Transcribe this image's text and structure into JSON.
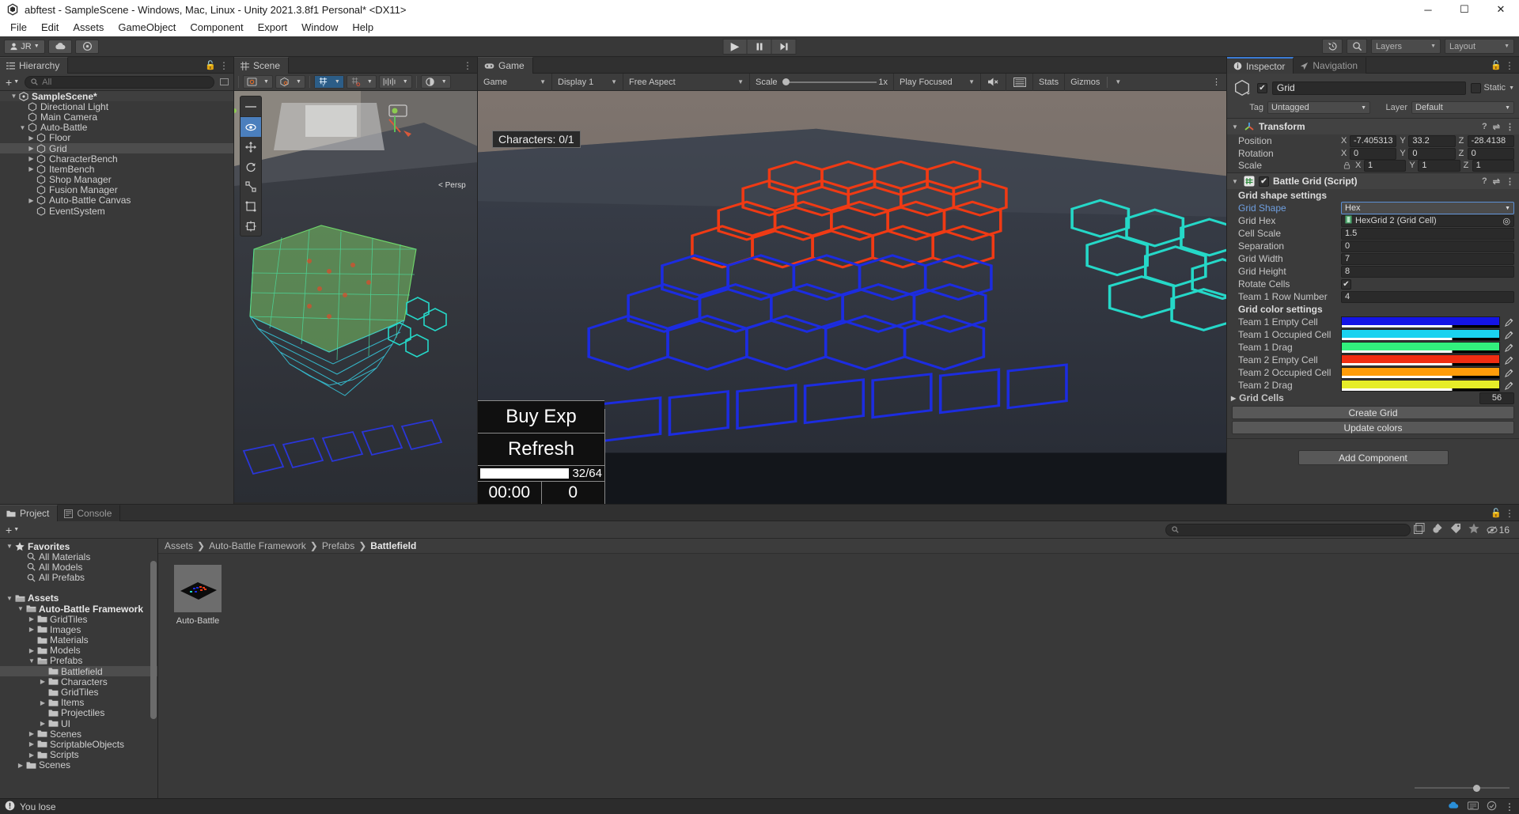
{
  "window": {
    "title": "abftest - SampleScene - Windows, Mac, Linux - Unity 2021.3.8f1 Personal* <DX11>",
    "minimize": "─",
    "maximize": "☐",
    "close": "✕"
  },
  "menubar": {
    "items": [
      "File",
      "Edit",
      "Assets",
      "GameObject",
      "Component",
      "Export",
      "Window",
      "Help"
    ]
  },
  "toolbar": {
    "account": "JR",
    "cloud_icon": "cloud-icon",
    "services_icon": "collab-icon",
    "play": "▶",
    "pause": "❙❙",
    "step": "▶❙",
    "undo_history_icon": "undo-history-icon",
    "search_icon": "search-icon",
    "layers": "Layers",
    "layout": "Layout"
  },
  "hierarchy": {
    "tab": "Hierarchy",
    "search_placeholder": "All",
    "add_label": "+",
    "items": [
      {
        "label": "SampleScene*",
        "depth": 0,
        "arrow": "down",
        "icon": "scene-icon",
        "selected": false,
        "scene": true
      },
      {
        "label": "Directional Light",
        "depth": 1,
        "arrow": "none",
        "icon": "gameobject-icon",
        "selected": false
      },
      {
        "label": "Main Camera",
        "depth": 1,
        "arrow": "none",
        "icon": "gameobject-icon",
        "selected": false
      },
      {
        "label": "Auto-Battle",
        "depth": 1,
        "arrow": "down",
        "icon": "gameobject-icon",
        "selected": false
      },
      {
        "label": "Floor",
        "depth": 2,
        "arrow": "right",
        "icon": "gameobject-icon",
        "selected": false
      },
      {
        "label": "Grid",
        "depth": 2,
        "arrow": "right",
        "icon": "gameobject-icon",
        "selected": true
      },
      {
        "label": "CharacterBench",
        "depth": 2,
        "arrow": "right",
        "icon": "gameobject-icon",
        "selected": false
      },
      {
        "label": "ItemBench",
        "depth": 2,
        "arrow": "right",
        "icon": "gameobject-icon",
        "selected": false
      },
      {
        "label": "Shop Manager",
        "depth": 2,
        "arrow": "none",
        "icon": "gameobject-icon",
        "selected": false
      },
      {
        "label": "Fusion Manager",
        "depth": 2,
        "arrow": "none",
        "icon": "gameobject-icon",
        "selected": false
      },
      {
        "label": "Auto-Battle Canvas",
        "depth": 2,
        "arrow": "right",
        "icon": "gameobject-icon",
        "selected": false
      },
      {
        "label": "EventSystem",
        "depth": 2,
        "arrow": "none",
        "icon": "gameobject-icon",
        "selected": false
      }
    ]
  },
  "scene_view": {
    "tab": "Scene",
    "persp_label": "< Persp",
    "tools": [
      "hand-tool",
      "move-tool",
      "rotate-tool",
      "scale-tool",
      "rect-tool",
      "transform-tool"
    ],
    "toolbar_groups": [
      "draw-mode",
      "2d-toggle",
      "lighting-toggle",
      "audio-toggle",
      "gizmos-visibility",
      "grid-snap",
      "fx-dropdown"
    ]
  },
  "game_view": {
    "tab": "Game",
    "display_mode": "Game",
    "display": "Display 1",
    "aspect": "Free Aspect",
    "scale_label": "Scale",
    "scale_value": "1x",
    "play_mode": "Play Focused",
    "mute_icon": "mute-audio-icon",
    "stats": "Stats",
    "gizmos": "Gizmos",
    "hud": {
      "characters": "Characters: 0/1",
      "buy_exp": "Buy Exp",
      "refresh": "Refresh",
      "gold_bar": "32/64",
      "timer": "00:00",
      "score": "0"
    }
  },
  "inspector": {
    "tab": "Inspector",
    "nav_tab": "Navigation",
    "object_name": "Grid",
    "enabled": true,
    "static_label": "Static",
    "tag_label": "Tag",
    "tag_value": "Untagged",
    "layer_label": "Layer",
    "layer_value": "Default",
    "transform": {
      "title": "Transform",
      "position_label": "Position",
      "rotation_label": "Rotation",
      "scale_label": "Scale",
      "position": {
        "x": "-7.405313",
        "y": "33.2",
        "z": "-28.4138"
      },
      "rotation": {
        "x": "0",
        "y": "0",
        "z": "0"
      },
      "scale": {
        "x": "1",
        "y": "1",
        "z": "1"
      },
      "axis": {
        "x": "X",
        "y": "Y",
        "z": "Z"
      }
    },
    "battle_grid": {
      "title": "Battle Grid (Script)",
      "enabled": true,
      "shape_section": "Grid shape settings",
      "grid_shape_label": "Grid Shape",
      "grid_shape_value": "Hex",
      "rows": [
        {
          "label": "Grid Hex",
          "value": "HexGrid 2 (Grid Cell)",
          "type": "object"
        },
        {
          "label": "Cell Scale",
          "value": "1.5",
          "type": "text"
        },
        {
          "label": "Separation",
          "value": "0",
          "type": "text"
        },
        {
          "label": "Grid Width",
          "value": "7",
          "type": "text"
        },
        {
          "label": "Grid Height",
          "value": "8",
          "type": "text"
        },
        {
          "label": "Rotate Cells",
          "value": "",
          "type": "checkbox",
          "checked": true
        },
        {
          "label": "Team 1 Row Number",
          "value": "4",
          "type": "text"
        }
      ],
      "color_section": "Grid color settings",
      "colors": [
        {
          "label": "Team 1 Empty Cell",
          "hex": "#1414e6"
        },
        {
          "label": "Team 1 Occupied Cell",
          "hex": "#1ad2f0"
        },
        {
          "label": "Team 1 Drag",
          "hex": "#32f07d"
        },
        {
          "label": "Team 2 Empty Cell",
          "hex": "#f02d12"
        },
        {
          "label": "Team 2 Occupied Cell",
          "hex": "#ff9c0a"
        },
        {
          "label": "Team 2 Drag",
          "hex": "#e6ed28"
        }
      ],
      "grid_cells_label": "Grid Cells",
      "grid_cells_count": "56",
      "create_grid": "Create Grid",
      "update_colors": "Update colors"
    },
    "add_component": "Add Component"
  },
  "project": {
    "tab": "Project",
    "console_tab": "Console",
    "add_label": "+",
    "search_placeholder": "",
    "hidden_count": "16",
    "breadcrumb": [
      "Assets",
      "Auto-Battle Framework",
      "Prefabs",
      "Battlefield"
    ],
    "tree": [
      {
        "label": "Favorites",
        "depth": 0,
        "arrow": "down",
        "icon": "star-icon",
        "bold": true
      },
      {
        "label": "All Materials",
        "depth": 1,
        "arrow": "none",
        "icon": "search-icon"
      },
      {
        "label": "All Models",
        "depth": 1,
        "arrow": "none",
        "icon": "search-icon"
      },
      {
        "label": "All Prefabs",
        "depth": 1,
        "arrow": "none",
        "icon": "search-icon"
      },
      {
        "label": "",
        "depth": 0,
        "arrow": "none",
        "icon": "none",
        "spacer": true
      },
      {
        "label": "Assets",
        "depth": 0,
        "arrow": "down",
        "icon": "folder-open-icon",
        "bold": true
      },
      {
        "label": "Auto-Battle Framework",
        "depth": 1,
        "arrow": "down",
        "icon": "folder-open-icon",
        "bold": true
      },
      {
        "label": "GridTiles",
        "depth": 2,
        "arrow": "right",
        "icon": "folder-icon"
      },
      {
        "label": "Images",
        "depth": 2,
        "arrow": "right",
        "icon": "folder-icon"
      },
      {
        "label": "Materials",
        "depth": 2,
        "arrow": "none",
        "icon": "folder-icon"
      },
      {
        "label": "Models",
        "depth": 2,
        "arrow": "right",
        "icon": "folder-icon"
      },
      {
        "label": "Prefabs",
        "depth": 2,
        "arrow": "down",
        "icon": "folder-open-icon"
      },
      {
        "label": "Battlefield",
        "depth": 3,
        "arrow": "none",
        "icon": "folder-icon",
        "selected": true
      },
      {
        "label": "Characters",
        "depth": 3,
        "arrow": "right",
        "icon": "folder-icon"
      },
      {
        "label": "GridTiles",
        "depth": 3,
        "arrow": "none",
        "icon": "folder-icon"
      },
      {
        "label": "Items",
        "depth": 3,
        "arrow": "right",
        "icon": "folder-icon"
      },
      {
        "label": "Projectiles",
        "depth": 3,
        "arrow": "none",
        "icon": "folder-icon"
      },
      {
        "label": "UI",
        "depth": 3,
        "arrow": "right",
        "icon": "folder-icon"
      },
      {
        "label": "Scenes",
        "depth": 2,
        "arrow": "right",
        "icon": "folder-icon"
      },
      {
        "label": "ScriptableObjects",
        "depth": 2,
        "arrow": "right",
        "icon": "folder-icon"
      },
      {
        "label": "Scripts",
        "depth": 2,
        "arrow": "right",
        "icon": "folder-icon"
      },
      {
        "label": "Scenes",
        "depth": 1,
        "arrow": "right",
        "icon": "folder-icon"
      }
    ],
    "assets": [
      {
        "name": "Auto-Battle",
        "thumb": "prefab-thumbnail"
      }
    ]
  },
  "statusbar": {
    "message": "You lose",
    "icon": "error-icon"
  }
}
